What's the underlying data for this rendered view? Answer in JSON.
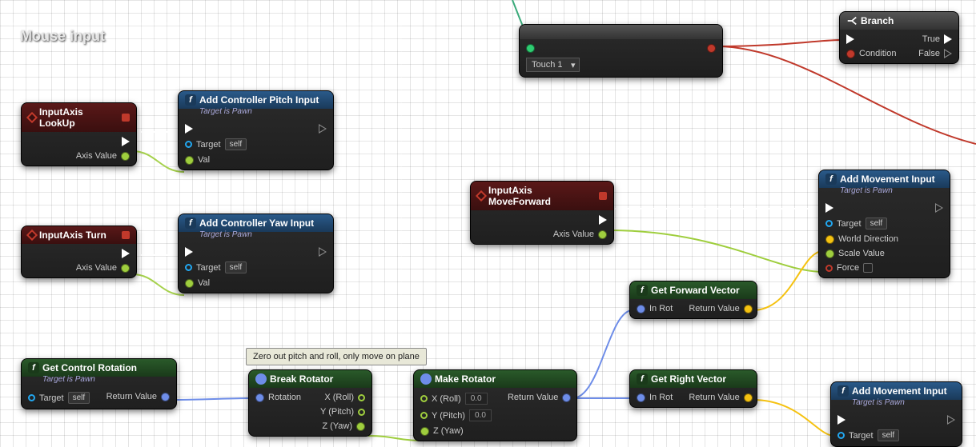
{
  "comment": {
    "title": "Mouse input"
  },
  "tooltip": "Zero out pitch and roll, only move on plane",
  "nodes": {
    "lookup": {
      "title": "InputAxis LookUp",
      "axis_value": "Axis Value"
    },
    "turn": {
      "title": "InputAxis Turn",
      "axis_value": "Axis Value"
    },
    "pitch": {
      "title": "Add Controller Pitch Input",
      "sub": "Target is Pawn",
      "target": "Target",
      "self": "self",
      "val": "Val"
    },
    "yaw": {
      "title": "Add Controller Yaw Input",
      "sub": "Target is Pawn",
      "target": "Target",
      "self": "self",
      "val": "Val"
    },
    "moveforward": {
      "title": "InputAxis MoveForward",
      "axis_value": "Axis Value"
    },
    "addmove1": {
      "title": "Add Movement Input",
      "sub": "Target is Pawn",
      "target": "Target",
      "self": "self",
      "worlddir": "World Direction",
      "scale": "Scale Value",
      "force": "Force"
    },
    "addmove2": {
      "title": "Add Movement Input",
      "sub": "Target is Pawn",
      "target": "Target",
      "self": "self"
    },
    "fwdvec": {
      "title": "Get Forward Vector",
      "inrot": "In Rot",
      "ret": "Return Value"
    },
    "rightvec": {
      "title": "Get Right Vector",
      "inrot": "In Rot",
      "ret": "Return Value"
    },
    "ctrlrot": {
      "title": "Get Control Rotation",
      "sub": "Target is Pawn",
      "target": "Target",
      "self": "self",
      "ret": "Return Value"
    },
    "breakrot": {
      "title": "Break Rotator",
      "rotation": "Rotation",
      "xroll": "X (Roll)",
      "ypitch": "Y (Pitch)",
      "zyaw": "Z (Yaw)"
    },
    "makerot": {
      "title": "Make Rotator",
      "xroll": "X (Roll)",
      "ypitch": "Y (Pitch)",
      "zyaw": "Z (Yaw)",
      "ret": "Return Value",
      "zero": "0.0"
    },
    "branch": {
      "title": "Branch",
      "true": "True",
      "false": "False",
      "cond": "Condition"
    },
    "touch": {
      "selected": "Touch 1"
    }
  }
}
